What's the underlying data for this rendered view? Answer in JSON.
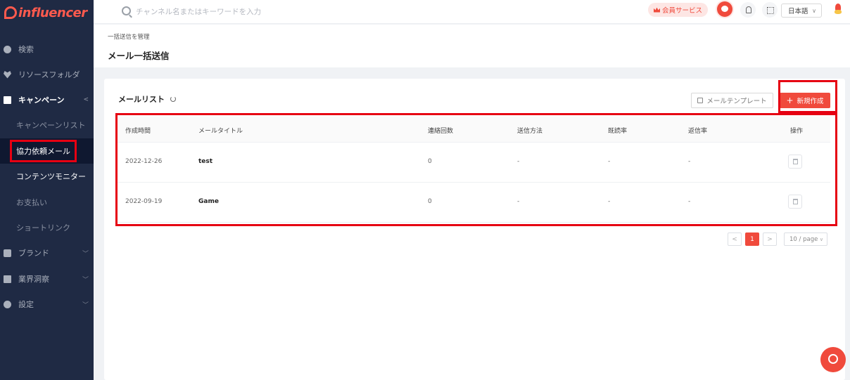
{
  "app": {
    "brand": "influencer"
  },
  "header": {
    "search_placeholder": "チャンネル名またはキーワードを入力",
    "vip_label": "会員サービス",
    "language": "日本語"
  },
  "sidebar": {
    "items": [
      {
        "label": "検索",
        "icon": "compass-icon"
      },
      {
        "label": "リソースフォルダ",
        "icon": "heart-icon"
      },
      {
        "label": "キャンペーン",
        "icon": "document-icon"
      },
      {
        "label": "ブランド",
        "icon": "brand-icon"
      },
      {
        "label": "業界洞察",
        "icon": "chart-icon"
      },
      {
        "label": "設定",
        "icon": "gear-icon"
      }
    ],
    "campaign_children": [
      "キャンペーンリスト",
      "協力依頼メール",
      "コンテンツモニター",
      "お支払い",
      "ショートリンク"
    ]
  },
  "page": {
    "breadcrumb": "一括送信を管理",
    "title": "メール一括送信"
  },
  "card": {
    "title": "メールリスト",
    "template_button": "メールテンプレート",
    "new_button": "新規作成"
  },
  "table": {
    "columns": [
      "作成時間",
      "メールタイトル",
      "連絡回数",
      "送信方法",
      "既読率",
      "返信率",
      "操作"
    ],
    "rows": [
      {
        "created": "2022-12-26",
        "title": "test",
        "count": "0",
        "method": "-",
        "read_rate": "-",
        "reply_rate": "-"
      },
      {
        "created": "2022-09-19",
        "title": "Game",
        "count": "0",
        "method": "-",
        "read_rate": "-",
        "reply_rate": "-"
      }
    ]
  },
  "pagination": {
    "prev": "<",
    "current": "1",
    "next": ">",
    "page_size": "10 / page"
  },
  "colors": {
    "accent": "#f04a3c",
    "sidebar": "#1f2a44",
    "highlight": "#e60012"
  }
}
